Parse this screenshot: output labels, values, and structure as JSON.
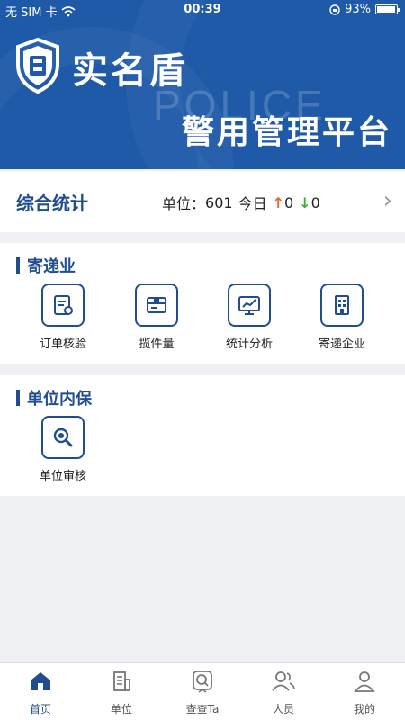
{
  "status_bar": {
    "carrier": "无 SIM 卡",
    "time": "00:39",
    "battery_percent": "93%",
    "battery_level": 0.93
  },
  "header": {
    "brand_name": "实名盾",
    "watermark": "POLICE",
    "platform_title": "警用管理平台"
  },
  "stats": {
    "title": "综合统计",
    "unit_label": "单位：",
    "unit_count": "601",
    "today_label": "今日",
    "up_count": "0",
    "down_count": "0"
  },
  "sections": {
    "courier": {
      "title": "寄递业",
      "items": [
        {
          "label": "订单核验",
          "icon": "order-verify-icon"
        },
        {
          "label": "揽件量",
          "icon": "parcel-icon"
        },
        {
          "label": "统计分析",
          "icon": "analytics-icon"
        },
        {
          "label": "寄递企业",
          "icon": "enterprise-icon"
        }
      ]
    },
    "unit": {
      "title": "单位内保",
      "items": [
        {
          "label": "单位审核",
          "icon": "search-audit-icon"
        }
      ]
    }
  },
  "tabbar": {
    "items": [
      {
        "label": "首页",
        "icon": "home-icon",
        "active": true
      },
      {
        "label": "单位",
        "icon": "building-icon",
        "active": false
      },
      {
        "label": "查查Ta",
        "icon": "search-person-icon",
        "active": false
      },
      {
        "label": "人员",
        "icon": "people-icon",
        "active": false
      },
      {
        "label": "我的",
        "icon": "user-icon",
        "active": false
      }
    ]
  },
  "colors": {
    "primary": "#1f5aa8",
    "accent_dark": "#1f4d8f",
    "up_arrow": "#e7642a",
    "down_arrow": "#3fae3a"
  }
}
